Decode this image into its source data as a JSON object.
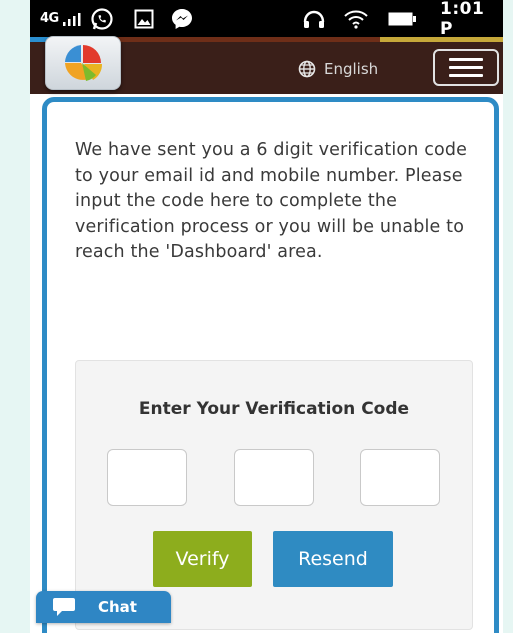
{
  "status_bar": {
    "network": "4G",
    "time": "1:01 P"
  },
  "colors": {
    "header_bg": "#3a1f19",
    "card_border": "#2e8bc5",
    "verify_button": "#8dad1d",
    "resend_button": "#2f8bc2",
    "chat_widget": "#2f86c4",
    "page_bg": "#e6f6f3"
  },
  "header": {
    "logo_icon": "pie-chart-app-logo",
    "language_icon": "globe-icon",
    "language": "English",
    "menu_icon": "hamburger-menu-icon"
  },
  "main": {
    "intro_text": "We have sent you a 6 digit verification code to your email id and mobile number. Please input the code here to complete the verification process or you will be unable to reach the 'Dashboard' area.",
    "code_panel": {
      "title": "Enter Your Verification Code",
      "inputs": [
        {
          "value": "",
          "placeholder": ""
        },
        {
          "value": "",
          "placeholder": ""
        },
        {
          "value": "",
          "placeholder": ""
        }
      ],
      "verify_label": "Verify",
      "resend_label": "Resend"
    }
  },
  "chat": {
    "icon": "chat-bubble-icon",
    "label": "Chat"
  }
}
